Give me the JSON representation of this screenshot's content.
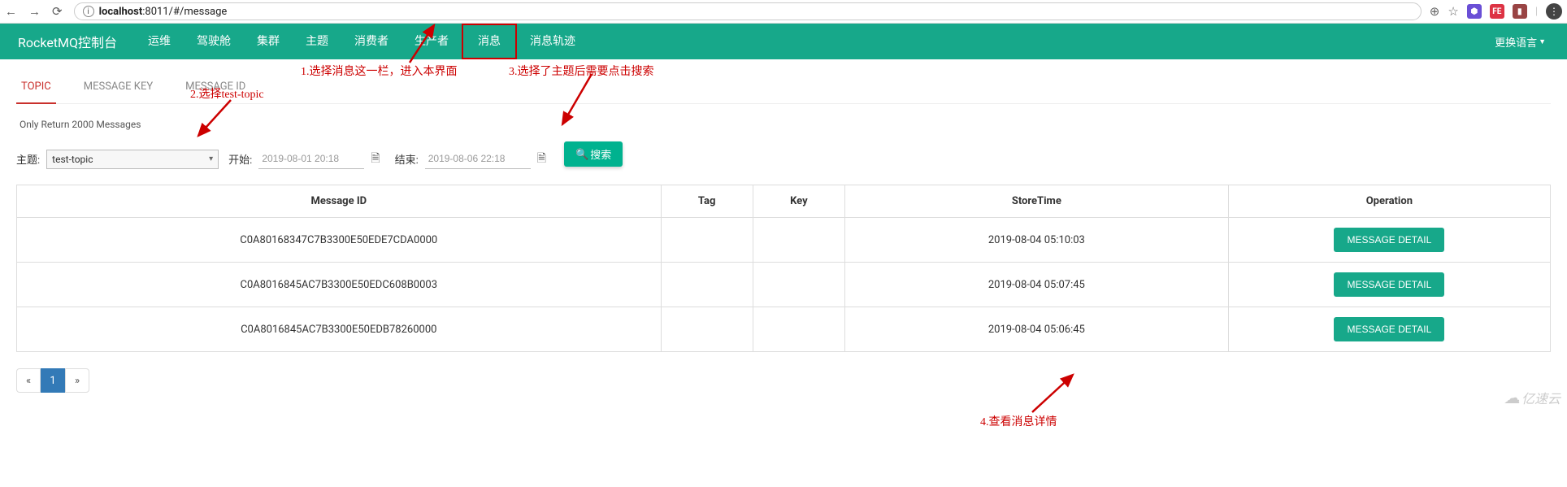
{
  "browser": {
    "url_prefix": "localhost",
    "url_rest": ":8011/#/message",
    "icons": {
      "search": "⊕",
      "star": "☆"
    }
  },
  "header": {
    "title": "RocketMQ控制台",
    "nav": [
      "运维",
      "驾驶舱",
      "集群",
      "主题",
      "消费者",
      "生产者",
      "消息",
      "消息轨迹"
    ],
    "lang": "更换语言"
  },
  "tabs": [
    "TOPIC",
    "MESSAGE KEY",
    "MESSAGE ID"
  ],
  "info": "Only Return 2000 Messages",
  "search": {
    "topic_label": "主题:",
    "topic_value": "test-topic",
    "start_label": "开始:",
    "start_value": "2019-08-01 20:18",
    "end_label": "结束:",
    "end_value": "2019-08-06 22:18",
    "button": "搜索"
  },
  "table": {
    "headers": {
      "msgid": "Message ID",
      "tag": "Tag",
      "key": "Key",
      "store": "StoreTime",
      "op": "Operation"
    },
    "detail_btn": "MESSAGE DETAIL",
    "rows": [
      {
        "msgid": "C0A80168347C7B3300E50EDE7CDA0000",
        "tag": "",
        "key": "",
        "store": "2019-08-04 05:10:03"
      },
      {
        "msgid": "C0A8016845AC7B3300E50EDC608B0003",
        "tag": "",
        "key": "",
        "store": "2019-08-04 05:07:45"
      },
      {
        "msgid": "C0A8016845AC7B3300E50EDB78260000",
        "tag": "",
        "key": "",
        "store": "2019-08-04 05:06:45"
      }
    ]
  },
  "pagination": {
    "prev": "«",
    "page": "1",
    "next": "»"
  },
  "annotations": {
    "a1": "1.选择消息这一栏，进入本界面",
    "a2": "2.选择test-topic",
    "a3": "3.选择了主题后需要点击搜索",
    "a4": "4.查看消息详情"
  },
  "watermark": "亿速云"
}
